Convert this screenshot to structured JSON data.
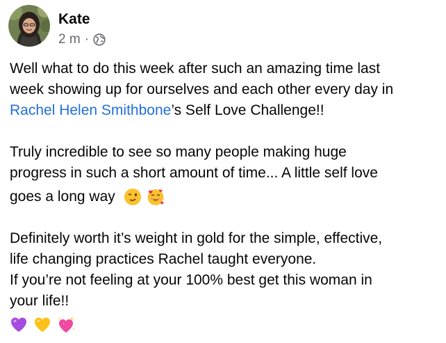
{
  "post": {
    "author": "Kate",
    "time": "2 m",
    "separator": "·",
    "audience_icon": "globe-icon",
    "mention": "Rachel Helen Smithbone",
    "p1": {
      "line1": "Well what to do this week after such an amazing time last",
      "line2": "week showing up for ourselves and each other every day in",
      "line3_after_mention": "’s Self Love Challenge!!"
    },
    "p2": {
      "line1": "Truly incredible to see so many people making huge",
      "line2": "progress in such a short amount of time... A little self love",
      "line3": "goes a long way"
    },
    "p3": {
      "line1": "Definitely worth it’s weight in gold for the simple, effective,",
      "line2": "life changing practices Rachel taught everyone.",
      "line3": "If you’re not feeling at your 100% best get this woman in",
      "line4": "your life!!"
    },
    "emojis_p2": [
      "winking-face-emoji",
      "smiling-face-with-hearts-emoji"
    ],
    "emojis_end": [
      "purple-heart-emoji",
      "yellow-heart-emoji",
      "sparkling-heart-emoji"
    ]
  },
  "colors": {
    "text": "#050505",
    "meta": "#65676b",
    "link": "#216fdb"
  }
}
